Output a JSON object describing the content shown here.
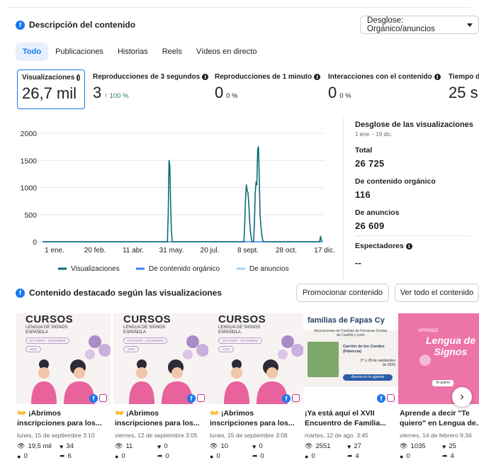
{
  "header": {
    "title": "Descripción del contenido",
    "dropdown_label": "Desglose: Orgánico/anuncios"
  },
  "tabs": [
    {
      "label": "Todo",
      "active": true
    },
    {
      "label": "Publicaciones",
      "active": false
    },
    {
      "label": "Historias",
      "active": false
    },
    {
      "label": "Reels",
      "active": false
    },
    {
      "label": "Vídeos en directo",
      "active": false
    }
  ],
  "metrics": [
    {
      "label": "Visualizaciones",
      "value": "26,7 mil",
      "delta": ""
    },
    {
      "label": "Reproducciones de 3 segundos",
      "value": "3",
      "delta": "↑ 100 %"
    },
    {
      "label": "Reproducciones de 1 minuto",
      "value": "0",
      "delta": "0 %"
    },
    {
      "label": "Interacciones con el contenido",
      "value": "0",
      "delta": "0 %"
    },
    {
      "label": "Tiempo d",
      "value": "25 s",
      "delta": ""
    }
  ],
  "chart_data": {
    "type": "line",
    "title": "",
    "x_ticks": [
      "1 ene.",
      "20 feb.",
      "11 abr.",
      "31 may.",
      "20 jul.",
      "8 sept.",
      "28 oct.",
      "17 dic."
    ],
    "x_range": [
      0,
      350
    ],
    "y_ticks": [
      0,
      500,
      1000,
      1500,
      2000
    ],
    "ylim": [
      0,
      2000
    ],
    "grid": true,
    "legend_position": "bottom",
    "series": [
      {
        "name": "Visualizaciones",
        "color": "#0b6e75",
        "x": [
          0,
          155,
          156,
          157,
          158,
          159,
          160,
          161,
          162,
          250,
          251,
          252,
          253,
          254,
          255,
          256,
          257,
          258,
          259,
          260,
          261,
          262,
          263,
          264,
          265,
          266,
          267,
          268,
          269,
          270,
          271,
          272,
          273,
          274,
          275,
          344,
          345,
          346,
          347
        ],
        "y": [
          0,
          0,
          500,
          1500,
          1400,
          700,
          200,
          0,
          0,
          0,
          350,
          800,
          1050,
          950,
          900,
          700,
          400,
          200,
          80,
          0,
          0,
          0,
          350,
          900,
          1100,
          1050,
          1700,
          1750,
          1200,
          500,
          300,
          150,
          50,
          0,
          0,
          0,
          100,
          40,
          0
        ]
      },
      {
        "name": "De contenido orgánico",
        "color": "#3b82f6",
        "x": [
          0,
          347
        ],
        "y": [
          0,
          0
        ]
      },
      {
        "name": "De anuncios",
        "color": "#a7d3f5",
        "x": [
          0,
          347
        ],
        "y": [
          0,
          0
        ]
      }
    ]
  },
  "breakdown": {
    "title": "Desglose de las visualizaciones",
    "range": "1 ene. - 19 dic.",
    "items": [
      {
        "label": "Total",
        "value": "26 725"
      },
      {
        "label": "De contenido orgánico",
        "value": "116"
      },
      {
        "label": "De anuncios",
        "value": "26 609"
      }
    ],
    "viewers_label": "Espectadores",
    "viewers_value": "--"
  },
  "featured": {
    "title": "Contenido destacado según las visualizaciones",
    "promote_label": "Promocionar contenido",
    "see_all_label": "Ver todo el contenido",
    "cards": [
      {
        "title": "👐 ¡Abrimos inscripciones para los...",
        "date": "lunes, 15 de septiembre 3:10",
        "views": "19,5 mil",
        "likes": "34",
        "comments": "0",
        "shares": "6",
        "thumb": "cursos"
      },
      {
        "title": "👐 ¡Abrimos inscripciones para los...",
        "date": "viernes, 12 de septiembre 3:05",
        "views": "11",
        "likes": "0",
        "comments": "0",
        "shares": "0",
        "thumb": "cursos"
      },
      {
        "title": "👐 ¡Abrimos inscripciones para los...",
        "date": "lunes, 15 de septiembre 3:08",
        "views": "10",
        "likes": "0",
        "comments": "0",
        "shares": "0",
        "thumb": "cursos"
      },
      {
        "title": "¡Ya está aquí el XVII Encuentro de Familia...",
        "date": "martes, 12 de ago. 3:45",
        "views": "2551",
        "likes": "27",
        "comments": "0",
        "shares": "4",
        "thumb": "encuentro"
      },
      {
        "title": "Aprende a decir \"Te quiero\" en Lengua de...",
        "date": "viernes, 14 de febrero 9:34",
        "views": "1035",
        "likes": "25",
        "comments": "0",
        "shares": "4",
        "thumb": "lengua"
      }
    ],
    "thumb_text": {
      "cursos_title": "CURSOS",
      "cursos_sub1": "LENGUA DE SIGNOS",
      "cursos_sub2": "ESPAÑOLA",
      "cursos_pill": "OCTUBRE - DICIEMBRE",
      "cursos_year": "2025",
      "encuentro_title": "familias de Fapas Cy",
      "encuentro_sub": "Asociaciones de Familias de Personas Sordas de Castilla y León",
      "encuentro_place": "Carrión de los Condes (Palencia)",
      "encuentro_dates": "27 y 28 de septiembre de 2025",
      "encuentro_btn": "Apunta en tu agenda",
      "lengua_small": "APRENDE",
      "lengua_big": "Lengua de Signos",
      "lengua_tag": "Te quiero"
    }
  },
  "colors": {
    "accent": "#1877f2",
    "views_line": "#0b6e75",
    "positive": "#2a8050",
    "pink": "#e8629b",
    "purple": "#b99bd0"
  }
}
